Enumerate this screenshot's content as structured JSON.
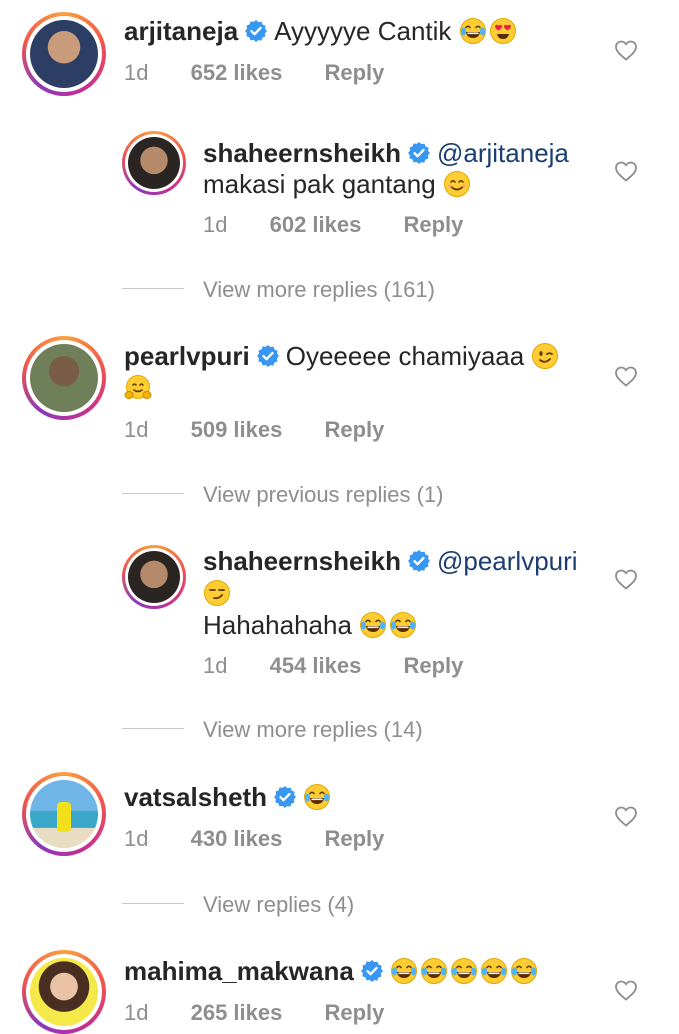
{
  "comments": [
    {
      "username": "arjitaneja",
      "text": "Ayyyyye Cantik",
      "emojis": [
        "laugh-cry-emoji",
        "heart-eyes-emoji"
      ],
      "time": "1d",
      "likes": "652 likes",
      "reply": "Reply"
    },
    {
      "username": "shaheernsheikh",
      "mention": "@arjitaneja",
      "text": "makasi pak gantang",
      "emojis": [
        "smile-emoji"
      ],
      "time": "1d",
      "likes": "602 likes",
      "reply": "Reply"
    },
    {
      "username": "pearlvpuri",
      "text": "Oyeeeee chamiyaaa",
      "emojis": [
        "wink-emoji",
        "hug-emoji"
      ],
      "time": "1d",
      "likes": "509 likes",
      "reply": "Reply"
    },
    {
      "username": "shaheernsheikh",
      "mention": "@pearlvpuri",
      "text": "Hahahahaha",
      "emojis": [
        "smirk-emoji",
        "laugh-cry-emoji",
        "laugh-cry-emoji"
      ],
      "time": "1d",
      "likes": "454 likes",
      "reply": "Reply"
    },
    {
      "username": "vatsalsheth",
      "text": "",
      "emojis": [
        "laugh-cry-emoji"
      ],
      "time": "1d",
      "likes": "430 likes",
      "reply": "Reply"
    },
    {
      "username": "mahima_makwana",
      "text": "",
      "emojis": [
        "laugh-cry-emoji",
        "laugh-cry-emoji",
        "laugh-cry-emoji",
        "laugh-cry-emoji",
        "laugh-cry-emoji"
      ],
      "time": "1d",
      "likes": "265 likes",
      "reply": "Reply"
    }
  ],
  "threads": {
    "more_replies_1": "View more replies (161)",
    "previous_replies": "View previous replies (1)",
    "more_replies_2": "View more replies (14)",
    "view_replies": "View replies (4)"
  },
  "colors": {
    "verified_badge": "#3897f0",
    "mention": "#1b3e72",
    "meta_text": "#8e8e8e",
    "ring_gradient": [
      "#f9a03c",
      "#f0564d",
      "#c92e8e",
      "#8a3ab9"
    ]
  }
}
